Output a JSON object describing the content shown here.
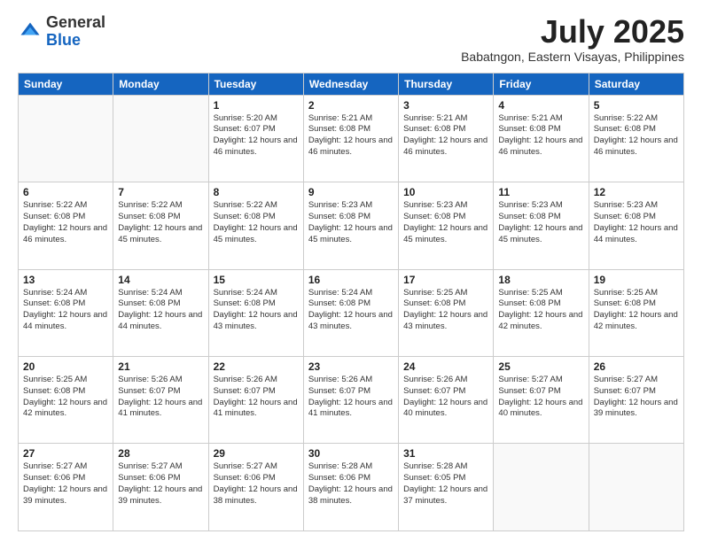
{
  "header": {
    "logo_general": "General",
    "logo_blue": "Blue",
    "month_title": "July 2025",
    "subtitle": "Babatngon, Eastern Visayas, Philippines"
  },
  "weekdays": [
    "Sunday",
    "Monday",
    "Tuesday",
    "Wednesday",
    "Thursday",
    "Friday",
    "Saturday"
  ],
  "weeks": [
    [
      {
        "day": "",
        "info": ""
      },
      {
        "day": "",
        "info": ""
      },
      {
        "day": "1",
        "info": "Sunrise: 5:20 AM\nSunset: 6:07 PM\nDaylight: 12 hours and 46 minutes."
      },
      {
        "day": "2",
        "info": "Sunrise: 5:21 AM\nSunset: 6:08 PM\nDaylight: 12 hours and 46 minutes."
      },
      {
        "day": "3",
        "info": "Sunrise: 5:21 AM\nSunset: 6:08 PM\nDaylight: 12 hours and 46 minutes."
      },
      {
        "day": "4",
        "info": "Sunrise: 5:21 AM\nSunset: 6:08 PM\nDaylight: 12 hours and 46 minutes."
      },
      {
        "day": "5",
        "info": "Sunrise: 5:22 AM\nSunset: 6:08 PM\nDaylight: 12 hours and 46 minutes."
      }
    ],
    [
      {
        "day": "6",
        "info": "Sunrise: 5:22 AM\nSunset: 6:08 PM\nDaylight: 12 hours and 46 minutes."
      },
      {
        "day": "7",
        "info": "Sunrise: 5:22 AM\nSunset: 6:08 PM\nDaylight: 12 hours and 45 minutes."
      },
      {
        "day": "8",
        "info": "Sunrise: 5:22 AM\nSunset: 6:08 PM\nDaylight: 12 hours and 45 minutes."
      },
      {
        "day": "9",
        "info": "Sunrise: 5:23 AM\nSunset: 6:08 PM\nDaylight: 12 hours and 45 minutes."
      },
      {
        "day": "10",
        "info": "Sunrise: 5:23 AM\nSunset: 6:08 PM\nDaylight: 12 hours and 45 minutes."
      },
      {
        "day": "11",
        "info": "Sunrise: 5:23 AM\nSunset: 6:08 PM\nDaylight: 12 hours and 45 minutes."
      },
      {
        "day": "12",
        "info": "Sunrise: 5:23 AM\nSunset: 6:08 PM\nDaylight: 12 hours and 44 minutes."
      }
    ],
    [
      {
        "day": "13",
        "info": "Sunrise: 5:24 AM\nSunset: 6:08 PM\nDaylight: 12 hours and 44 minutes."
      },
      {
        "day": "14",
        "info": "Sunrise: 5:24 AM\nSunset: 6:08 PM\nDaylight: 12 hours and 44 minutes."
      },
      {
        "day": "15",
        "info": "Sunrise: 5:24 AM\nSunset: 6:08 PM\nDaylight: 12 hours and 43 minutes."
      },
      {
        "day": "16",
        "info": "Sunrise: 5:24 AM\nSunset: 6:08 PM\nDaylight: 12 hours and 43 minutes."
      },
      {
        "day": "17",
        "info": "Sunrise: 5:25 AM\nSunset: 6:08 PM\nDaylight: 12 hours and 43 minutes."
      },
      {
        "day": "18",
        "info": "Sunrise: 5:25 AM\nSunset: 6:08 PM\nDaylight: 12 hours and 42 minutes."
      },
      {
        "day": "19",
        "info": "Sunrise: 5:25 AM\nSunset: 6:08 PM\nDaylight: 12 hours and 42 minutes."
      }
    ],
    [
      {
        "day": "20",
        "info": "Sunrise: 5:25 AM\nSunset: 6:08 PM\nDaylight: 12 hours and 42 minutes."
      },
      {
        "day": "21",
        "info": "Sunrise: 5:26 AM\nSunset: 6:07 PM\nDaylight: 12 hours and 41 minutes."
      },
      {
        "day": "22",
        "info": "Sunrise: 5:26 AM\nSunset: 6:07 PM\nDaylight: 12 hours and 41 minutes."
      },
      {
        "day": "23",
        "info": "Sunrise: 5:26 AM\nSunset: 6:07 PM\nDaylight: 12 hours and 41 minutes."
      },
      {
        "day": "24",
        "info": "Sunrise: 5:26 AM\nSunset: 6:07 PM\nDaylight: 12 hours and 40 minutes."
      },
      {
        "day": "25",
        "info": "Sunrise: 5:27 AM\nSunset: 6:07 PM\nDaylight: 12 hours and 40 minutes."
      },
      {
        "day": "26",
        "info": "Sunrise: 5:27 AM\nSunset: 6:07 PM\nDaylight: 12 hours and 39 minutes."
      }
    ],
    [
      {
        "day": "27",
        "info": "Sunrise: 5:27 AM\nSunset: 6:06 PM\nDaylight: 12 hours and 39 minutes."
      },
      {
        "day": "28",
        "info": "Sunrise: 5:27 AM\nSunset: 6:06 PM\nDaylight: 12 hours and 39 minutes."
      },
      {
        "day": "29",
        "info": "Sunrise: 5:27 AM\nSunset: 6:06 PM\nDaylight: 12 hours and 38 minutes."
      },
      {
        "day": "30",
        "info": "Sunrise: 5:28 AM\nSunset: 6:06 PM\nDaylight: 12 hours and 38 minutes."
      },
      {
        "day": "31",
        "info": "Sunrise: 5:28 AM\nSunset: 6:05 PM\nDaylight: 12 hours and 37 minutes."
      },
      {
        "day": "",
        "info": ""
      },
      {
        "day": "",
        "info": ""
      }
    ]
  ]
}
